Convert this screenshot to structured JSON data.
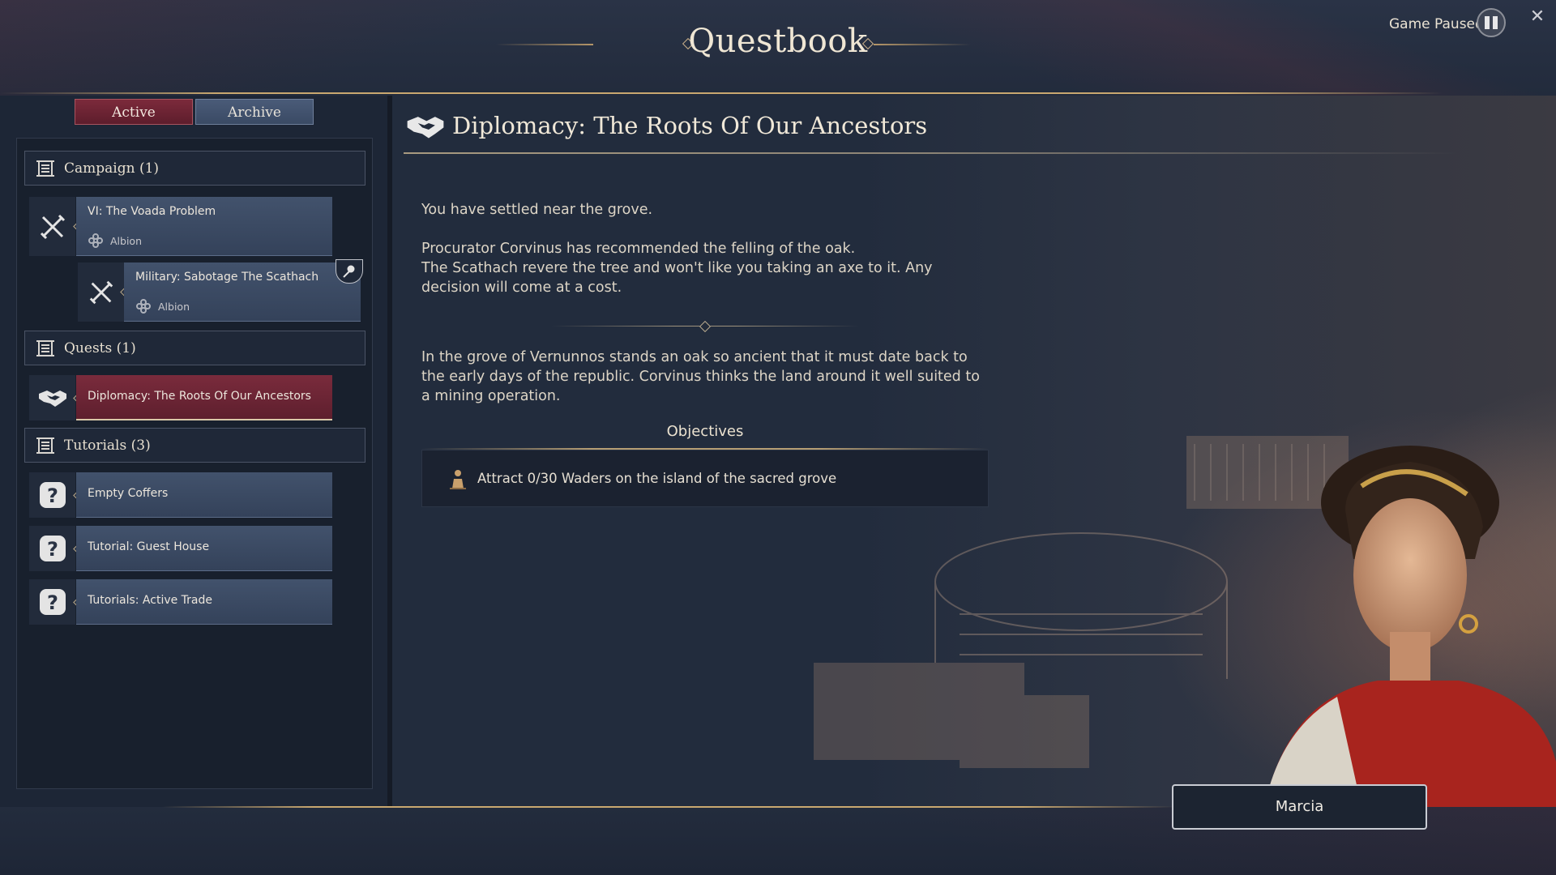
{
  "window": {
    "title": "Questbook"
  },
  "top_right": {
    "status_text": "Game Paused",
    "pause_icon": "pause-icon",
    "close_icon": "close-icon"
  },
  "tabs": [
    {
      "label": "Active",
      "selected": true
    },
    {
      "label": "Archive",
      "selected": false
    }
  ],
  "sidebar": {
    "sections": [
      {
        "label": "Campaign (1)",
        "items": [
          {
            "label": "VI: The Voada Problem",
            "region": "Albion",
            "icon": "crossed-swords-icon"
          },
          {
            "label": "Military: Sabotage The Scathach",
            "region": "Albion",
            "icon": "crossed-swords-icon"
          }
        ]
      },
      {
        "label": "Quests (1)",
        "items": [
          {
            "label": "Diplomacy: The Roots Of Our Ancestors",
            "icon": "handshake-icon",
            "selected": true
          }
        ]
      },
      {
        "label": "Tutorials (3)",
        "items": [
          {
            "label": "Empty Coffers",
            "icon": "question-icon"
          },
          {
            "label": "Tutorial: Guest House",
            "icon": "question-icon"
          },
          {
            "label": "Tutorials: Active Trade",
            "icon": "question-icon"
          }
        ]
      }
    ]
  },
  "detail": {
    "title": "Diplomacy: The Roots Of Our Ancestors",
    "paragraph_1": "You have settled near the grove.",
    "paragraph_2": "Procurator Corvinus has recommended the felling of the oak.",
    "paragraph_3": "The Scathach revere the tree and won't like you taking an axe to it. Any decision will come at a cost.",
    "paragraph_4": "In the grove of Vernunnos stands an oak so ancient that it must date back to the early days of the republic. Corvinus thinks the land around it well suited to a mining operation.",
    "objectives_title": "Objectives",
    "objectives": [
      {
        "text": "Attract 0/30 Waders on the island of the sacred grove",
        "icon": "wader-icon"
      }
    ]
  },
  "character": {
    "name": "Marcia"
  },
  "colors": {
    "accent_red": "#7c2a3b",
    "gold": "#c9a870",
    "panel_blue": "#42526c"
  }
}
